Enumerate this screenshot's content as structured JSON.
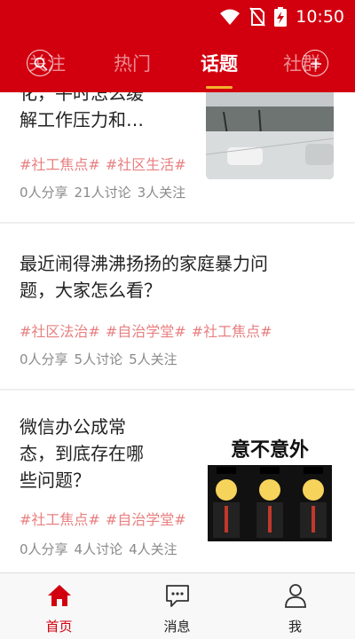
{
  "status_bar": {
    "time": "10:50"
  },
  "tabs": [
    {
      "label": "关注",
      "active": false
    },
    {
      "label": "热门",
      "active": false
    },
    {
      "label": "话题",
      "active": true
    },
    {
      "label": "社群",
      "active": false
    }
  ],
  "topics": [
    {
      "title_lines": [
        "化，平时怎么缓",
        "解工作压力和…"
      ],
      "tags": [
        "#社工焦点#",
        "#社区生活#"
      ],
      "stats": [
        "0人分享",
        "21人讨论",
        "3人关注"
      ]
    },
    {
      "title_lines": [
        "最近闹得沸沸扬扬的家庭暴力问",
        "题，大家怎么看？"
      ],
      "tags": [
        "#社区法治#",
        "#自治学堂#",
        "#社工焦点#"
      ],
      "stats": [
        "0人分享",
        "5人讨论",
        "5人关注"
      ]
    },
    {
      "title_lines": [
        "微信办公成常",
        "态，到底存在哪",
        "些问题？"
      ],
      "tags": [
        "#社工焦点#",
        "#自治学堂#"
      ],
      "stats": [
        "0人分享",
        "4人讨论",
        "4人关注"
      ],
      "image_text": "意不意外"
    }
  ],
  "bottom_nav": [
    {
      "label": "首页",
      "active": true
    },
    {
      "label": "消息",
      "active": false
    },
    {
      "label": "我",
      "active": false
    }
  ],
  "colors": {
    "brand_red": "#d2000f",
    "tag_pink": "#e87f80",
    "tab_underline": "#f3b22c"
  }
}
